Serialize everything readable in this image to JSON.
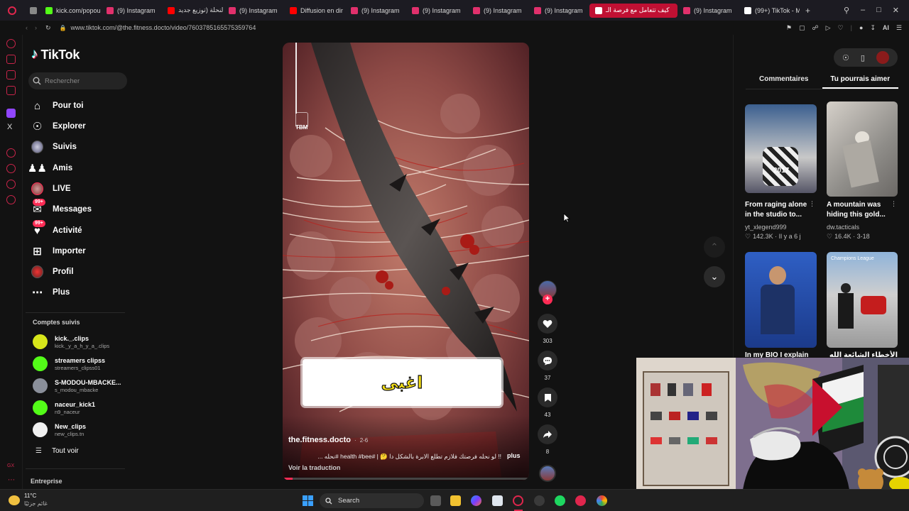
{
  "browser": {
    "tabs": [
      {
        "label": "",
        "color": "#888888"
      },
      {
        "label": "kick.com/popou",
        "color": "#53fc18"
      },
      {
        "label": "(9) Instagram",
        "color": "#e1306c"
      },
      {
        "label": "النحلة (توزيع جديد",
        "color": "#ff0000"
      },
      {
        "label": "(9) Instagram",
        "color": "#e1306c"
      },
      {
        "label": "Diffusion en dir",
        "color": "#ff0000"
      },
      {
        "label": "(9) Instagram",
        "color": "#e1306c"
      },
      {
        "label": "(9) Instagram",
        "color": "#e1306c"
      },
      {
        "label": "(9) Instagram",
        "color": "#e1306c"
      },
      {
        "label": "(9) Instagram",
        "color": "#e1306c"
      },
      {
        "label": "كيف تتعامل مع فرصة الـ",
        "color": "#ffffff",
        "active": true
      },
      {
        "label": "(9) Instagram",
        "color": "#e1306c"
      },
      {
        "label": "(99+) TikTok - M",
        "color": "#ffffff"
      }
    ],
    "url": "www.tiktok.com/@the.fitness.docto/video/7603785165575359764",
    "ai_label": "AI"
  },
  "sidebar": {
    "logo": "TikTok",
    "search_placeholder": "Rechercher",
    "nav": [
      {
        "label": "Pour toi",
        "icon": "home-icon"
      },
      {
        "label": "Explorer",
        "icon": "compass-icon"
      },
      {
        "label": "Suivis",
        "icon": "following-avatar-icon"
      },
      {
        "label": "Amis",
        "icon": "friends-icon"
      },
      {
        "label": "LIVE",
        "icon": "live-avatar-icon"
      },
      {
        "label": "Messages",
        "icon": "messages-icon",
        "badge": "99+"
      },
      {
        "label": "Activité",
        "icon": "activity-icon",
        "badge": "99+"
      },
      {
        "label": "Importer",
        "icon": "upload-icon"
      },
      {
        "label": "Profil",
        "icon": "profile-avatar-icon"
      },
      {
        "label": "Plus",
        "icon": "more-icon"
      }
    ],
    "followed_title": "Comptes suivis",
    "followed": [
      {
        "name": "kick._.clips",
        "handle": "kick._y_a_h_y_a_.clips",
        "color": "#d7e61a"
      },
      {
        "name": "streamers clipss",
        "handle": "streamers_clipss01",
        "color": "#53fc18"
      },
      {
        "name": "S-MODOU-MBACKE...",
        "handle": "s_modou_mbacke",
        "color": "#8a8f9a"
      },
      {
        "name": "naceur_kick1",
        "handle": "n9_naceur",
        "color": "#53fc18"
      },
      {
        "name": "New_clips",
        "handle": "new_clips.tn",
        "color": "#f0f0f0"
      }
    ],
    "see_all": "Tout voir",
    "company": "Entreprise"
  },
  "video": {
    "caption_overlay": "اغبى",
    "watermark": "TBM",
    "author": "the.fitness.docto",
    "date": "2-6",
    "description": "!! لو نحله فرصتك فلازم تطلع الابرة بالشكل دا 🤔 | #health #bee #نحله ...",
    "more": "plus",
    "translate": "Voir la traduction",
    "likes": "303",
    "comments": "37",
    "saves": "43",
    "shares": "8"
  },
  "right_panel": {
    "tabs": [
      "Commentaires",
      "Tu pourrais aimer"
    ],
    "active_tab": "Tu pourrais aimer",
    "cards": [
      {
        "title": "From raging alone in the studio to...",
        "author": "yt_xlegend999",
        "stats": "142.3K · Il y a 6 j",
        "thumb_text": "2017"
      },
      {
        "title": "A mountain was hiding this gold...",
        "author": "dw.tacticals",
        "stats": "16.4K · 3-18",
        "thumb_text": ""
      },
      {
        "title": "In my BIO I explain",
        "author": "",
        "stats": "",
        "thumb_text": ""
      },
      {
        "title": "الأخطاء الشائعة الله",
        "author": "",
        "stats": "",
        "thumb_text": "Champions League"
      }
    ]
  },
  "webcam": {
    "description": "streamer webcam overlay"
  },
  "taskbar": {
    "weather_temp": "11°C",
    "weather_desc": "غائم جزئيًا",
    "search_label": "Search"
  }
}
